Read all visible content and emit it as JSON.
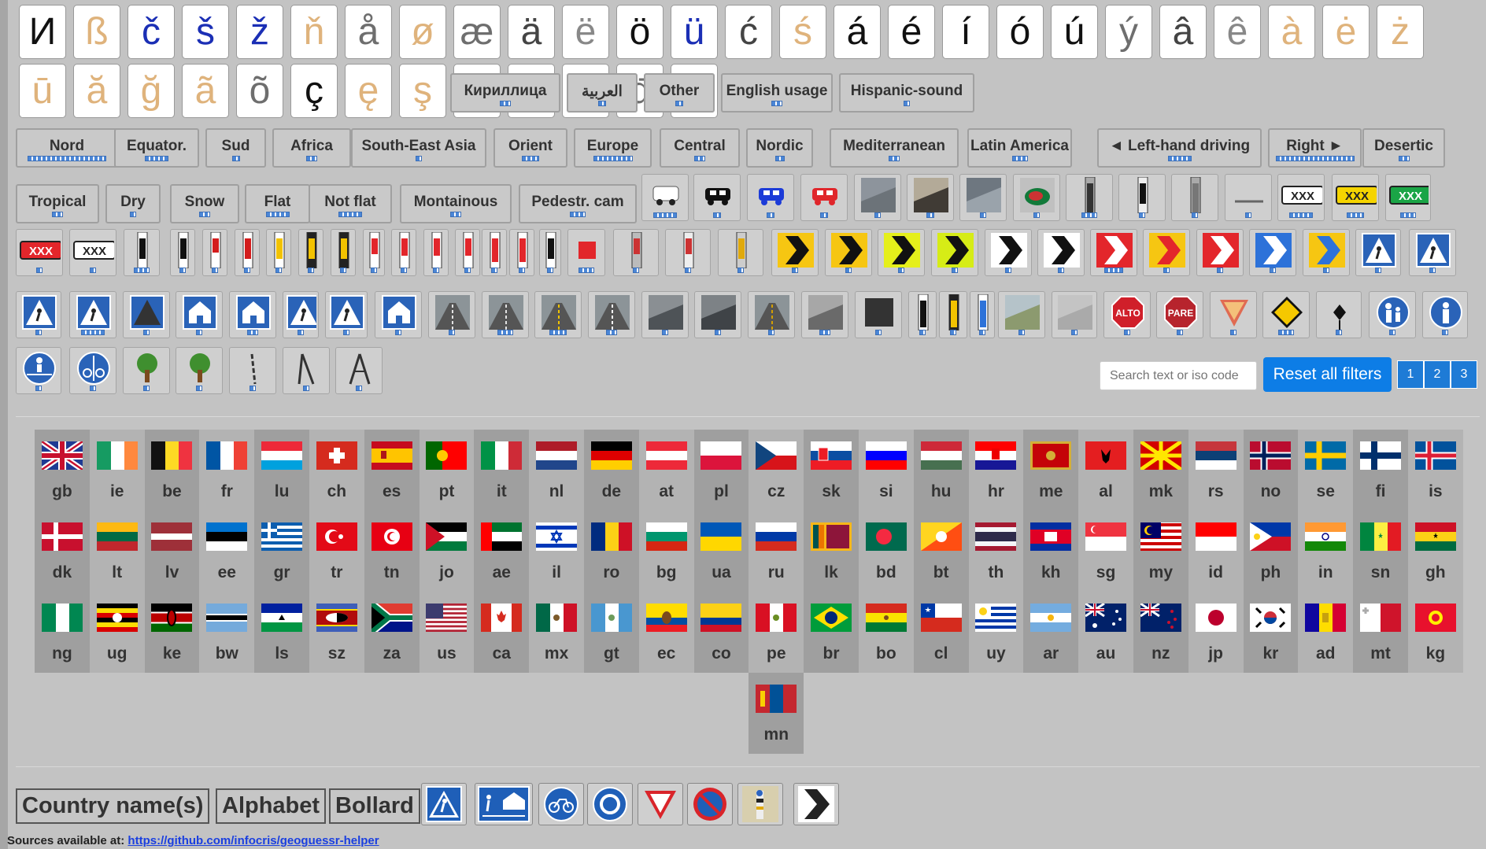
{
  "letters": [
    {
      "ch": "И",
      "c": "c1"
    },
    {
      "ch": "ß",
      "c": "c2"
    },
    {
      "ch": "č",
      "c": "c3"
    },
    {
      "ch": "š",
      "c": "c3"
    },
    {
      "ch": "ž",
      "c": "c3"
    },
    {
      "ch": "ň",
      "c": "c2"
    },
    {
      "ch": "å",
      "c": "c6"
    },
    {
      "ch": "ø",
      "c": "c2"
    },
    {
      "ch": "æ",
      "c": "c6"
    },
    {
      "ch": "ä",
      "c": "c4"
    },
    {
      "ch": "ë",
      "c": "c5"
    },
    {
      "ch": "ö",
      "c": "c1"
    },
    {
      "ch": "ü",
      "c": "c3"
    },
    {
      "ch": "ć",
      "c": "c4"
    },
    {
      "ch": "ś",
      "c": "c2"
    },
    {
      "ch": "á",
      "c": "c1"
    },
    {
      "ch": "é",
      "c": "c1"
    },
    {
      "ch": "í",
      "c": "c1"
    },
    {
      "ch": "ó",
      "c": "c1"
    },
    {
      "ch": "ú",
      "c": "c1"
    },
    {
      "ch": "ý",
      "c": "c6"
    },
    {
      "ch": "â",
      "c": "c4"
    },
    {
      "ch": "ê",
      "c": "c5"
    },
    {
      "ch": "à",
      "c": "c2"
    },
    {
      "ch": "ė",
      "c": "c2"
    },
    {
      "ch": "ż",
      "c": "c2"
    },
    {
      "ch": "ū",
      "c": "c2"
    },
    {
      "ch": "ă",
      "c": "c2"
    },
    {
      "ch": "ğ",
      "c": "c2"
    },
    {
      "ch": "ã",
      "c": "c2"
    },
    {
      "ch": "õ",
      "c": "c6"
    },
    {
      "ch": "ç",
      "c": "c1"
    },
    {
      "ch": "ę",
      "c": "c2"
    },
    {
      "ch": "ş",
      "c": "c2"
    },
    {
      "ch": "ļ",
      "c": "c2"
    },
    {
      "ch": "Ł",
      "c": "c2"
    },
    {
      "ch": "ħ",
      "c": "c2"
    },
    {
      "ch": "đ",
      "c": "c6"
    },
    {
      "ch": "ð",
      "c": "c2"
    }
  ],
  "alphabet_chips": [
    {
      "label": "Кириллица",
      "w": 140,
      "bar": 14
    },
    {
      "label": "العربية",
      "w": 90,
      "bar": 10
    },
    {
      "label": "Other",
      "w": 90,
      "bar": 10
    },
    {
      "label": "English usage",
      "w": 142,
      "bar": 14
    },
    {
      "label": "Hispanic-sound",
      "w": 172,
      "bar": 8
    }
  ],
  "region_chips": [
    {
      "label": "Nord",
      "bar": 100
    },
    {
      "label": "Equator.",
      "bar": 30
    },
    {
      "label": "Sud",
      "bar": 10
    },
    {
      "label": "Africa",
      "bar": 14
    },
    {
      "label": "South-East Asia",
      "bar": 8
    },
    {
      "label": "Orient",
      "bar": 22
    },
    {
      "label": "Europe",
      "bar": 50
    },
    {
      "label": "Central",
      "bar": 14
    },
    {
      "label": "Nordic",
      "bar": 12
    },
    {
      "label": "Mediterranean",
      "bar": 14
    },
    {
      "label": "Latin America",
      "bar": 20
    },
    {
      "label": "◄ Left-hand driving",
      "bar": 30
    },
    {
      "label": "Right ►",
      "bar": 100
    },
    {
      "label": "Desertic",
      "bar": 14
    }
  ],
  "terrain_chips": [
    {
      "label": "Tropical",
      "bar": 14
    },
    {
      "label": "Dry",
      "bar": 8
    },
    {
      "label": "Snow",
      "bar": 14
    },
    {
      "label": "Flat",
      "bar": 30
    },
    {
      "label": "Not flat",
      "bar": 30
    },
    {
      "label": "Montainous",
      "bar": 14
    },
    {
      "label": "Pedestr. cam",
      "bar": 20
    }
  ],
  "search": {
    "placeholder": "Search text or iso code"
  },
  "reset_label": "Reset all filters",
  "pages": [
    "1",
    "2",
    "3"
  ],
  "flags": [
    "gb",
    "ie",
    "be",
    "fr",
    "lu",
    "ch",
    "es",
    "pt",
    "it",
    "nl",
    "de",
    "at",
    "pl",
    "cz",
    "sk",
    "si",
    "hu",
    "hr",
    "me",
    "al",
    "mk",
    "rs",
    "no",
    "se",
    "fi",
    "is",
    "dk",
    "lt",
    "lv",
    "ee",
    "gr",
    "tr",
    "tn",
    "jo",
    "ae",
    "il",
    "ro",
    "bg",
    "ua",
    "ru",
    "lk",
    "bd",
    "bt",
    "th",
    "kh",
    "sg",
    "my",
    "id",
    "ph",
    "in",
    "sn",
    "gh",
    "ng",
    "ug",
    "ke",
    "bw",
    "ls",
    "sz",
    "za",
    "us",
    "ca",
    "mx",
    "gt",
    "ec",
    "co",
    "pe",
    "br",
    "bo",
    "cl",
    "uy",
    "ar",
    "au",
    "nz",
    "jp",
    "kr",
    "ad",
    "mt",
    "kg",
    "mn"
  ],
  "bottom_tabs": [
    "Country name(s)",
    "Alphabet",
    "Bollard"
  ],
  "source": {
    "label": "Sources available at:",
    "url": "https://github.com/infocris/geoguessr-helper"
  }
}
